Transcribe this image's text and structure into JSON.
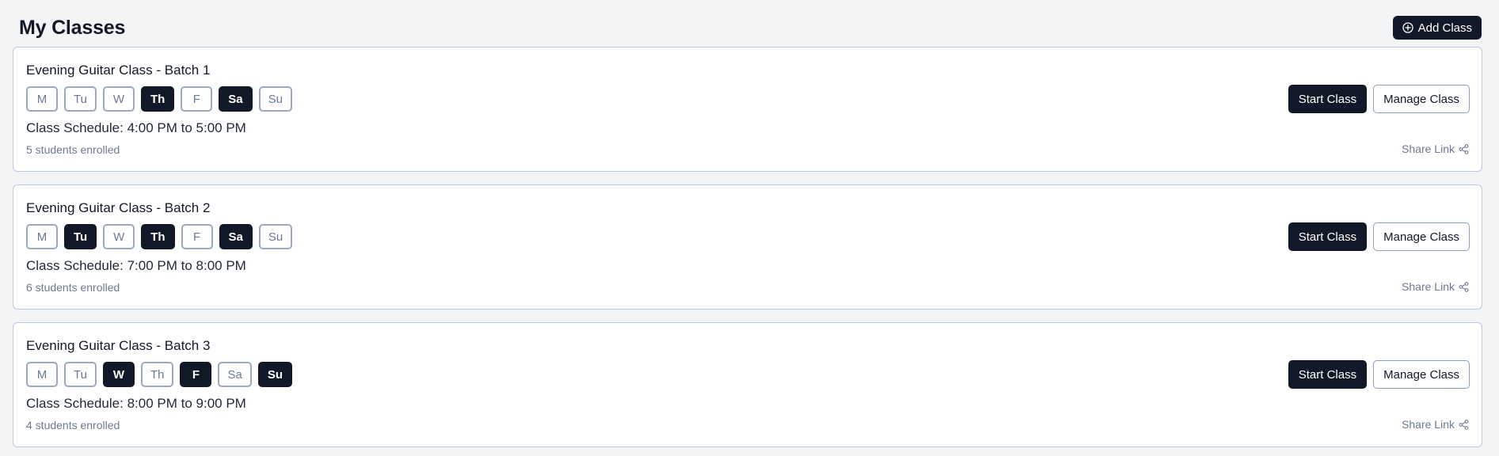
{
  "header": {
    "title": "My Classes",
    "add_button_label": "Add Class",
    "add_icon": "plus-circle-icon"
  },
  "labels": {
    "schedule_prefix": "Class Schedule:",
    "start_button": "Start Class",
    "manage_button": "Manage Class",
    "share_link": "Share Link",
    "share_icon": "share-icon"
  },
  "colors": {
    "background": "#f3f4f6",
    "primary": "#111827",
    "border": "#b9c8dc",
    "muted_text": "#6b7a90"
  },
  "classes": [
    {
      "title": "Evening Guitar Class - Batch 1",
      "days": [
        {
          "label": "M",
          "active": false
        },
        {
          "label": "Tu",
          "active": false
        },
        {
          "label": "W",
          "active": false
        },
        {
          "label": "Th",
          "active": true
        },
        {
          "label": "F",
          "active": false
        },
        {
          "label": "Sa",
          "active": true
        },
        {
          "label": "Su",
          "active": false
        }
      ],
      "schedule": "4:00 PM to 5:00 PM",
      "enrolled": "5 students enrolled"
    },
    {
      "title": "Evening Guitar Class - Batch 2",
      "days": [
        {
          "label": "M",
          "active": false
        },
        {
          "label": "Tu",
          "active": true
        },
        {
          "label": "W",
          "active": false
        },
        {
          "label": "Th",
          "active": true
        },
        {
          "label": "F",
          "active": false
        },
        {
          "label": "Sa",
          "active": true
        },
        {
          "label": "Su",
          "active": false
        }
      ],
      "schedule": "7:00 PM to 8:00 PM",
      "enrolled": "6 students enrolled"
    },
    {
      "title": "Evening Guitar Class - Batch 3",
      "days": [
        {
          "label": "M",
          "active": false
        },
        {
          "label": "Tu",
          "active": false
        },
        {
          "label": "W",
          "active": true
        },
        {
          "label": "Th",
          "active": false
        },
        {
          "label": "F",
          "active": true
        },
        {
          "label": "Sa",
          "active": false
        },
        {
          "label": "Su",
          "active": true
        }
      ],
      "schedule": "8:00 PM to 9:00 PM",
      "enrolled": "4 students enrolled"
    }
  ]
}
